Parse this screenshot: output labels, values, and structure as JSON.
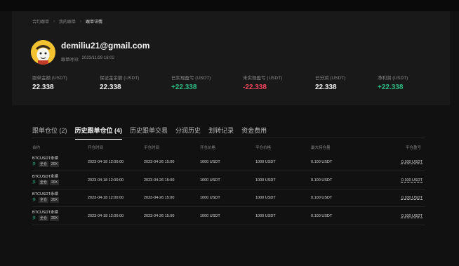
{
  "breadcrumb": [
    "合约跟单",
    "我的跟单",
    "跟单详情"
  ],
  "profile": {
    "email": "demiliu21@gmail.com",
    "follow_time_label": "跟单时间:",
    "follow_time": "2023/11/29 18:02"
  },
  "stats": [
    {
      "label": "跟单金额 (USDT)",
      "value": "22.338",
      "color": "white"
    },
    {
      "label": "保证金余额 (USDT)",
      "value": "22.338",
      "color": "white"
    },
    {
      "label": "已实现盈亏 (USDT)",
      "value": "+22.338",
      "color": "green"
    },
    {
      "label": "未实现盈亏 (USDT)",
      "value": "-22.338",
      "color": "red"
    },
    {
      "label": "已分润 (USDT)",
      "value": "22.338",
      "color": "white"
    },
    {
      "label": "净利润 (USDT)",
      "value": "+22.338",
      "color": "green"
    }
  ],
  "tabs": [
    {
      "label": "跟单仓位 (2)",
      "active": false
    },
    {
      "label": "历史跟单仓位 (4)",
      "active": true
    },
    {
      "label": "历史跟单交易",
      "active": false
    },
    {
      "label": "分润历史",
      "active": false
    },
    {
      "label": "划转记录",
      "active": false
    },
    {
      "label": "资金费用",
      "active": false
    }
  ],
  "table": {
    "headers": [
      "合约",
      "开仓时间",
      "平仓时间",
      "开仓价格",
      "平仓价格",
      "最大持仓量",
      "平仓盈亏"
    ],
    "rows": [
      {
        "symbol": "BTCUSDT永续",
        "direction": "多",
        "margin_mode": "全仓",
        "leverage": "20X",
        "open_time": "2023-04-18 12:00:00",
        "close_time": "2023-04-26 15:00",
        "open_price": "1000 USDT",
        "close_price": "1000 USDT",
        "max_position": "0.100 USDT",
        "pnl": "0.100 USDT"
      },
      {
        "symbol": "BTCUSDT永续",
        "direction": "多",
        "margin_mode": "全仓",
        "leverage": "20X",
        "open_time": "2023-04-18 12:00:00",
        "close_time": "2023-04-26 15:00",
        "open_price": "1000 USDT",
        "close_price": "1000 USDT",
        "max_position": "0.100 USDT",
        "pnl": "0.100 USDT"
      },
      {
        "symbol": "BTCUSDT永续",
        "direction": "多",
        "margin_mode": "全仓",
        "leverage": "20X",
        "open_time": "2023-04-18 12:00:00",
        "close_time": "2023-04-26 15:00",
        "open_price": "1000 USDT",
        "close_price": "1000 USDT",
        "max_position": "0.100 USDT",
        "pnl": "0.100 USDT"
      },
      {
        "symbol": "BTCUSDT永续",
        "direction": "多",
        "margin_mode": "全仓",
        "leverage": "20X",
        "open_time": "2023-04-18 12:00:00",
        "close_time": "2023-04-26 15:00",
        "open_price": "1000 USDT",
        "close_price": "1000 USDT",
        "max_position": "0.100 USDT",
        "pnl": "0.100 USDT"
      }
    ]
  },
  "colors": {
    "green": "#2ebd85",
    "red": "#f6465d",
    "background": "#111111",
    "card": "#191919"
  }
}
